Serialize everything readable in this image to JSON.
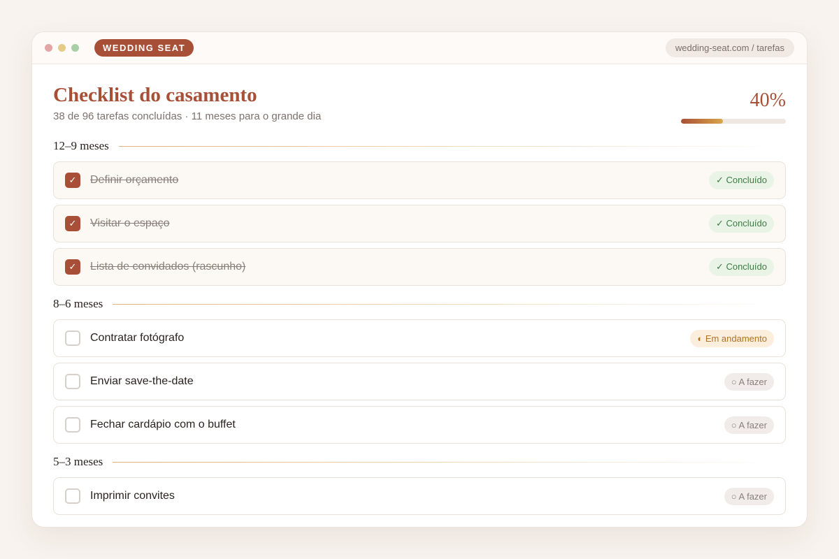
{
  "window": {
    "brand": "WEDDING SEAT",
    "url": "wedding-seat.com / tarefas"
  },
  "header": {
    "title": "Checklist do casamento",
    "subtitle": "38 de 96 tarefas concluídas · 11 meses para o grande dia",
    "progress_label": "40%",
    "progress_fraction": 0.4
  },
  "sections": [
    {
      "label": "12–9 meses",
      "tasks": [
        {
          "label": "Definir orçamento",
          "status": "done",
          "badge": "✓ Concluído"
        },
        {
          "label": "Visitar o espaço",
          "status": "done",
          "badge": "✓ Concluído"
        },
        {
          "label": "Lista de convidados (rascunho)",
          "status": "done",
          "badge": "✓ Concluído"
        }
      ]
    },
    {
      "label": "8–6 meses",
      "tasks": [
        {
          "label": "Contratar fotógrafo",
          "status": "progress",
          "badge": "◐ Em andamento"
        },
        {
          "label": "Enviar save-the-date",
          "status": "todo",
          "badge": "○ A fazer"
        },
        {
          "label": "Fechar cardápio com o buffet",
          "status": "todo",
          "badge": "○ A fazer"
        }
      ]
    },
    {
      "label": "5–3 meses",
      "tasks": [
        {
          "label": "Imprimir convites",
          "status": "todo",
          "badge": "○ A fazer"
        }
      ]
    }
  ],
  "colors": {
    "accent": "#a84f37",
    "gold": "#d9a64a",
    "done_badge": "#3f7a43",
    "progress_badge": "#b07322"
  },
  "icons": {
    "check": "✓"
  }
}
